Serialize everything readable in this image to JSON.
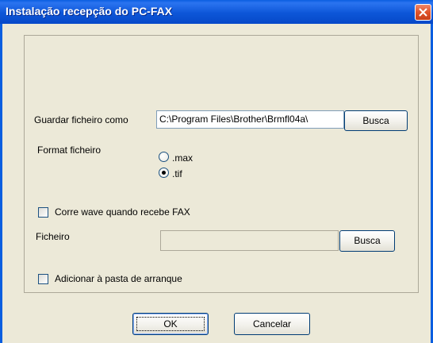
{
  "window": {
    "title": "Instalação recepção do PC-FAX"
  },
  "save": {
    "label": "Guardar ficheiro como",
    "path": "C:\\Program Files\\Brother\\Brmfl04a\\",
    "browse_label": "Busca"
  },
  "format": {
    "label": "Format ficheiro",
    "options": [
      ".max",
      ".tif"
    ],
    "selected": ".tif"
  },
  "wave": {
    "checkbox_label": "Corre wave quando recebe FAX",
    "checked": false,
    "file_label": "Ficheiro",
    "file_value": "",
    "browse_label": "Busca"
  },
  "startup": {
    "checkbox_label": "Adicionar à pasta de arranque",
    "checked": false
  },
  "buttons": {
    "ok_label": "OK",
    "cancel_label": "Cancelar"
  }
}
